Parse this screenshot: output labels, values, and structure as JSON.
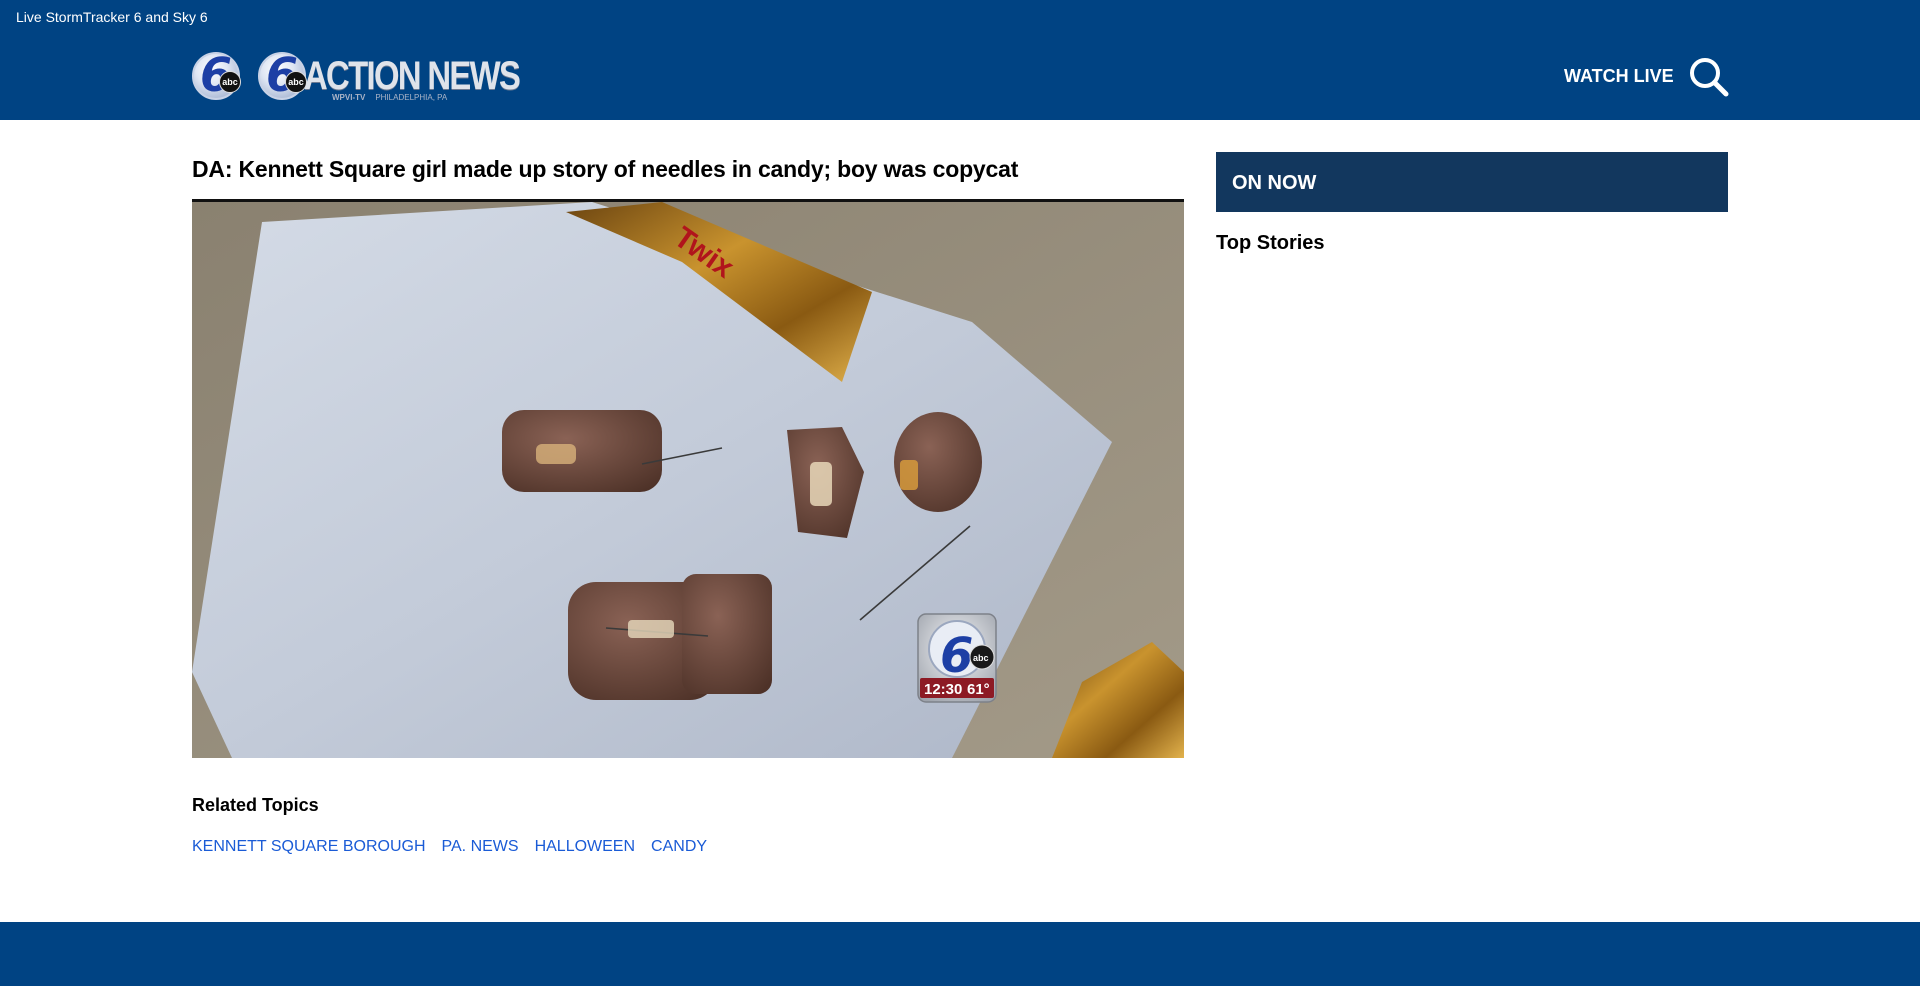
{
  "header": {
    "top_link": "Live StormTracker 6 and Sky 6",
    "logo_small": {
      "numeral": "6",
      "badge": "abc"
    },
    "logo_main": {
      "numeral": "6",
      "badge": "abc",
      "title": "ACTION NEWS",
      "callsign": "WPVI-TV",
      "location": "PHILADELPHIA, PA"
    },
    "watch_live": "WATCH LIVE",
    "search_icon": "search-icon"
  },
  "article": {
    "headline": "DA: Kennett Square girl made up story of needles in candy; boy was copycat",
    "video_bug": {
      "numeral": "6",
      "badge": "abc",
      "time": "12:30",
      "temperature": "61°"
    },
    "wrapper_text": "Twix",
    "related_heading": "Related Topics",
    "topics": [
      "KENNETT SQUARE BOROUGH",
      "PA. NEWS",
      "HALLOWEEN",
      "CANDY"
    ]
  },
  "sidebar": {
    "on_now": "ON NOW",
    "top_stories": "Top Stories"
  },
  "colors": {
    "brand_blue": "#004383",
    "on_now_bg": "#12375e",
    "link_blue": "#1a5bd6"
  }
}
